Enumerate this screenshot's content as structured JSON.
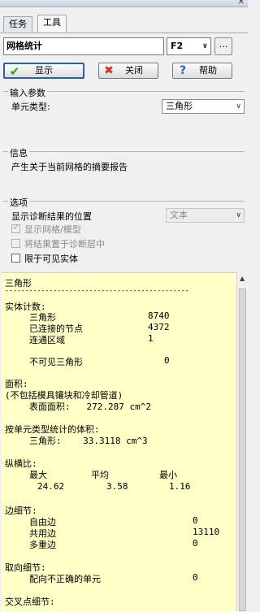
{
  "tabs": [
    "任务",
    "工具"
  ],
  "mesh": {
    "name": "网格统计",
    "shortcut": "F2",
    "more_label": "..."
  },
  "buttons": {
    "show": "显示",
    "close": "关闭",
    "help": "帮助"
  },
  "input_group": {
    "title": "输入参数",
    "element_type_label": "单元类型:",
    "element_type_value": "三角形"
  },
  "info_group": {
    "title": "信息",
    "text": "产生关于当前网格的摘要报告"
  },
  "options_group": {
    "title": "选项",
    "location_label": "显示诊断结果的位置",
    "location_value": "文本",
    "show_mesh_label": "显示网格/模型",
    "layer_label": "将结果置于诊断层中",
    "visible_label": "限于可见实体"
  },
  "report": {
    "title": "三角形",
    "divider": "----------------------------------------------",
    "entity_count_header": "实体计数:",
    "triangles_label": "三角形",
    "triangles_value": "8740",
    "nodes_label": "已连接的节点",
    "nodes_value": "4372",
    "regions_label": "连通区域",
    "regions_value": "1",
    "invisible_label": "不可见三角形",
    "invisible_value": "0",
    "area_header": "面积:",
    "area_note": "(不包括模具镶块和冷却管道)",
    "surface_area": "表面面积:   272.287 cm^2",
    "volume_header": "按单元类型统计的体积:",
    "volume_line": "三角形:    33.3118 cm^3",
    "aspect_header": "纵横比:",
    "aspect_cols": [
      "最大",
      "平均",
      "最小"
    ],
    "aspect_vals": [
      "24.62",
      "3.58",
      "1.16"
    ],
    "edge_header": "边细节:",
    "free_edge_label": "自由边",
    "free_edge_value": "0",
    "shared_edge_label": "共用边",
    "shared_edge_value": "13110",
    "multi_edge_label": "多重边",
    "multi_edge_value": "0",
    "orient_header": "取向细节:",
    "orient_label": "配向不正确的单元",
    "orient_value": "0",
    "intersect_header": "交叉点细节:"
  },
  "colors": {
    "report_bg": "#ffffc8",
    "check_green": "#2aa12a",
    "close_red": "#d23030",
    "help_blue": "#2a5fc0"
  }
}
